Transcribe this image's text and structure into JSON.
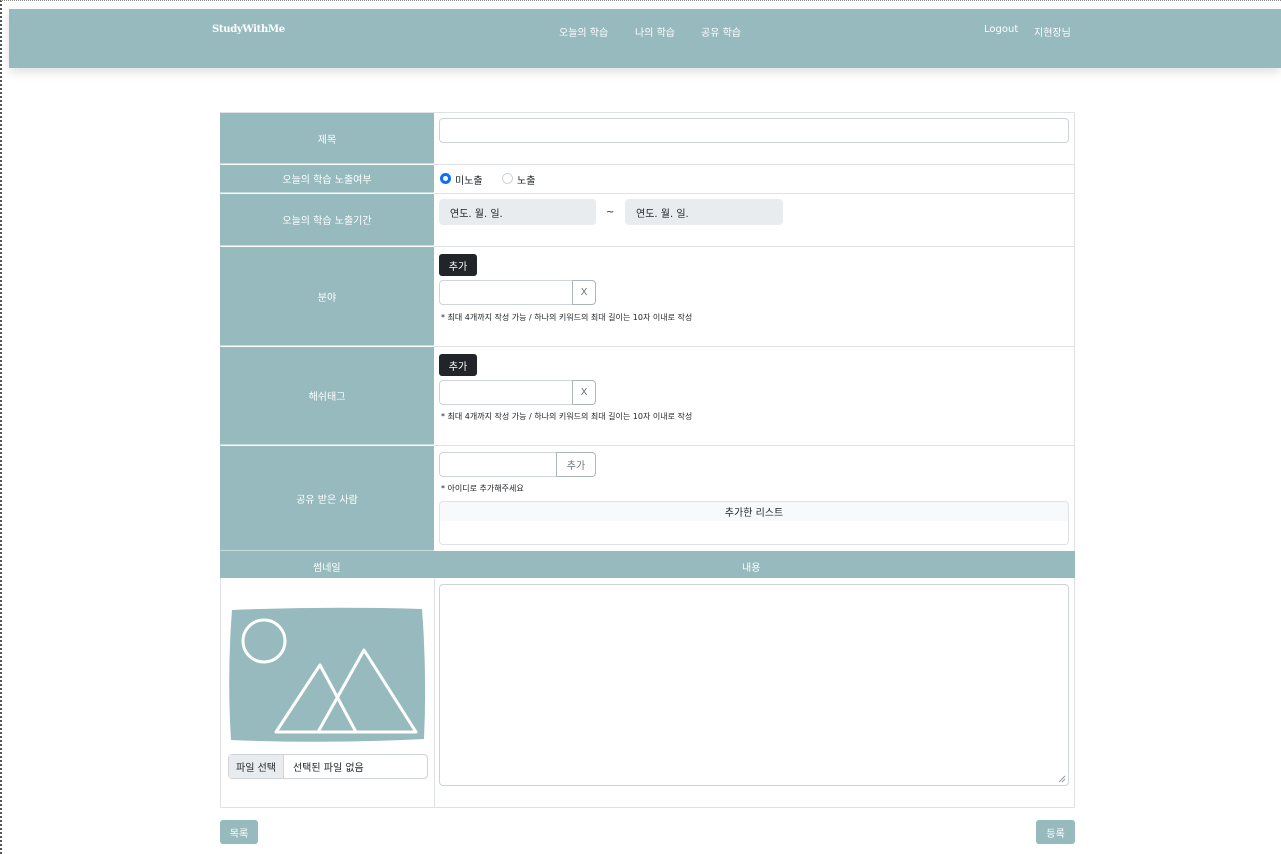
{
  "navbar": {
    "brand": "StudyWithMe",
    "links": [
      "오늘의 학습",
      "나의 학습",
      "공유 학습"
    ],
    "logout": "Logout",
    "user": "지현장님"
  },
  "form": {
    "title_label": "제목",
    "title_value": "",
    "exposure_label": "오늘의 학습 노출여부",
    "exposure_options": [
      "미노출",
      "노출"
    ],
    "exposure_selected": "미노출",
    "period_label": "오늘의 학습 노출기간",
    "date_start": "연도. 월. 일.",
    "date_separator": "~",
    "date_end": "연도. 월. 일.",
    "field_label": "분야",
    "field_add": "추가",
    "field_remove": "X",
    "field_hint": "* 최대 4개까지 작성 가능 / 하나의 키워드의 최대 길이는 10자 이내로 작성",
    "hashtag_label": "해쉬태그",
    "hashtag_add": "추가",
    "hashtag_remove": "X",
    "hashtag_hint": "* 최대 4개까지 작성 가능 / 하나의 키워드의 최대 길이는 10자 이내로 작성",
    "share_label": "공유 받은 사람",
    "share_add": "추가",
    "share_hint": "* 아이디로 추가해주세요",
    "share_list_header": "추가한 리스트",
    "thumbnail_header": "썸네일",
    "content_header": "내용",
    "file_button": "파일 선택",
    "file_status": "선택된 파일 없음"
  },
  "buttons": {
    "list": "목록",
    "submit": "등록"
  },
  "colors": {
    "accent": "#96babd",
    "dark_button": "#212529",
    "radio_selected": "#0d6efd"
  }
}
